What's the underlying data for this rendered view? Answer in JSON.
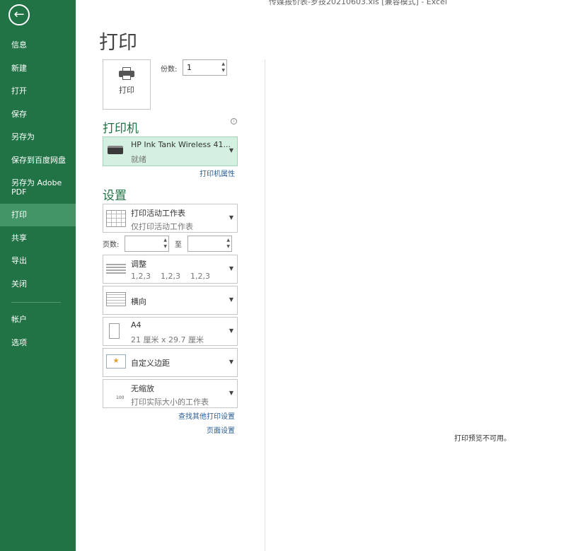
{
  "window": {
    "title": "传媒报价表-罗技20210603.xls  [兼容模式] - Excel"
  },
  "sidebar": {
    "items": [
      {
        "label": "信息"
      },
      {
        "label": "新建"
      },
      {
        "label": "打开"
      },
      {
        "label": "保存"
      },
      {
        "label": "另存为"
      },
      {
        "label": "保存到百度网盘"
      },
      {
        "label": "另存为 Adobe PDF"
      },
      {
        "label": "打印",
        "selected": true
      },
      {
        "label": "共享"
      },
      {
        "label": "导出"
      },
      {
        "label": "关闭"
      },
      {
        "label": "帐户"
      },
      {
        "label": "选项"
      }
    ]
  },
  "main": {
    "title": "打印",
    "print_button": "打印",
    "copies_label": "份数:",
    "copies_value": "1",
    "printer": {
      "heading": "打印机",
      "name": "HP Ink Tank Wireless 41...",
      "status": "就绪",
      "properties_link": "打印机属性"
    },
    "settings": {
      "heading": "设置",
      "what": {
        "title": "打印活动工作表",
        "sub": "仅打印活动工作表"
      },
      "pages_label": "页数:",
      "to_label": "至",
      "collate": {
        "title": "调整",
        "sub": "1,2,3    1,2,3    1,2,3"
      },
      "orientation": {
        "title": "横向"
      },
      "paper": {
        "title": "A4",
        "sub": "21 厘米 x 29.7 厘米"
      },
      "margins": {
        "title": "自定义边距"
      },
      "scaling": {
        "title": "无缩放",
        "sub": "打印实际大小的工作表"
      },
      "more_link": "查找其他打印设置",
      "page_setup_link": "页面设置"
    }
  },
  "preview": {
    "message": "打印预览不可用。"
  },
  "colors": {
    "accent": "#217346",
    "printer_bg": "#d3f0e0"
  }
}
